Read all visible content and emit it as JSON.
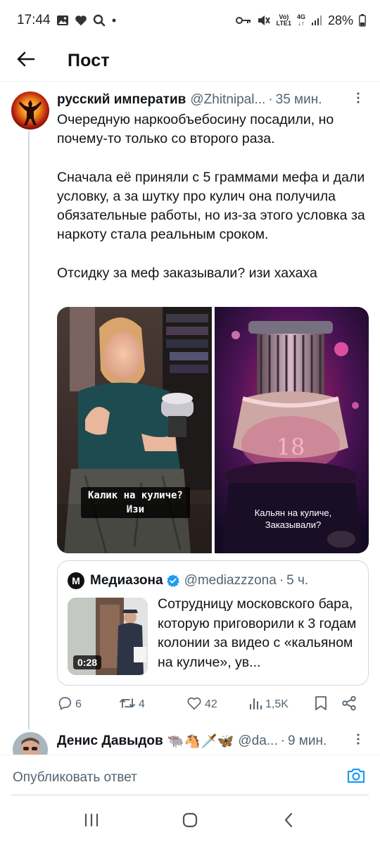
{
  "status_bar": {
    "time": "17:44",
    "network_top": "Vo)",
    "network_bottom": "LTE1",
    "signal_type": "4G",
    "battery": "28%"
  },
  "header": {
    "title": "Пост",
    "back_icon": "arrow-left-icon"
  },
  "tweet": {
    "author_name": "русский императив",
    "author_handle": "@Zhitnipal...",
    "separator": "·",
    "time_ago": "35 мин.",
    "text_lines": [
      "Очередную наркообъебосину посадили, но почему-то только со второго раза.",
      "Сначала её приняли с 5 граммами мефа и дали условку, а за шутку про кулич она получила обязательные работы, но из-за этого условка за наркоту стала реальным сроком.",
      "Отсидку за меф заказывали? изи хахаха"
    ],
    "media": [
      {
        "caption_line1": "Калик на куличе?",
        "caption_line2": "Изи"
      },
      {
        "caption_line1": "Кальян на куличе,",
        "caption_line2": "Заказывали?"
      }
    ],
    "quote": {
      "logo_letter": "M",
      "name": "Медиазона",
      "handle": "@mediazzzona",
      "time_ago": "5 ч.",
      "text": "Сотрудницу московского бара, которую приговорили к 3 годам колонии за видео с «кальяном на куличе», ув...",
      "video_duration": "0:28"
    },
    "actions": {
      "replies": "6",
      "retweets": "4",
      "likes": "42",
      "views": "1,5K"
    }
  },
  "next_reply": {
    "author_name": "Денис Давыдов",
    "emojis": "🐃🐴🗡️🦋",
    "author_handle": "@da...",
    "separator": "·",
    "time_ago": "9 мин."
  },
  "compose": {
    "placeholder": "Опубликовать ответ"
  },
  "colors": {
    "accent": "#1d9bf0",
    "text_primary": "#0f1419",
    "text_secondary": "#536471",
    "border": "#cfd9de"
  }
}
